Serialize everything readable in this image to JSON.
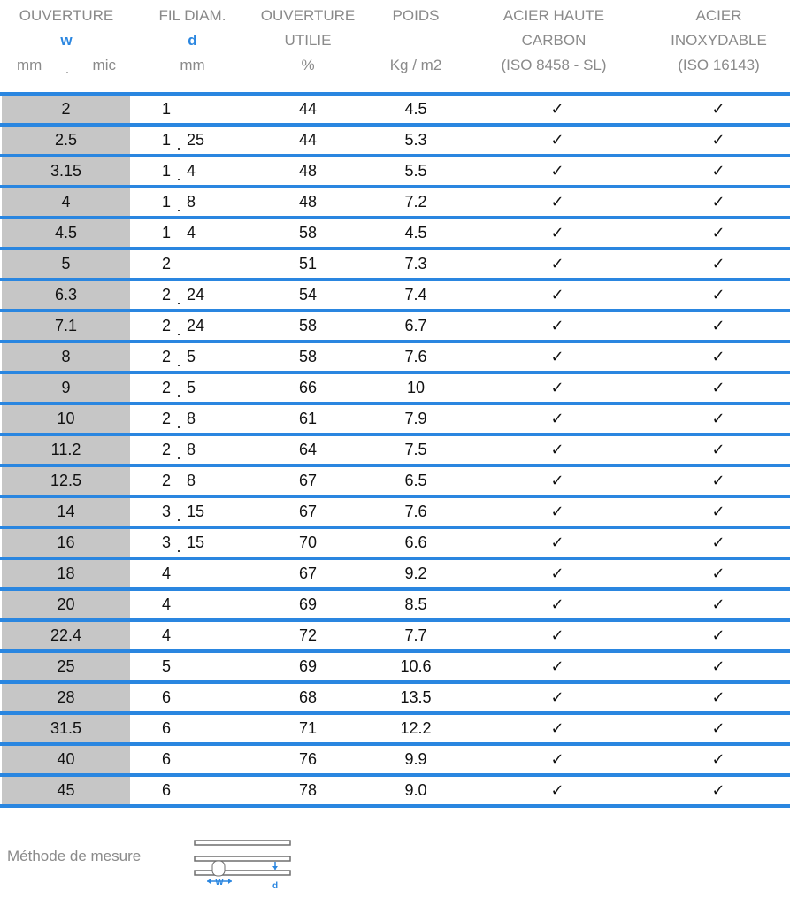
{
  "header": {
    "col_w": {
      "line1": "OUVERTURE",
      "symbol": "w",
      "unit_left": "mm",
      "unit_sep": ".",
      "unit_right": "mic"
    },
    "col_d": {
      "line1": "FIL DIAM.",
      "symbol": "d",
      "unit": "mm"
    },
    "col_o": {
      "line1": "OUVERTURE",
      "line2": "UTILIE",
      "unit": "%"
    },
    "col_p": {
      "line1": "POIDS",
      "unit": "Kg / m2"
    },
    "col_a": {
      "line1": "ACIER HAUTE",
      "line2": "CARBON",
      "line3": "(ISO 8458 - SL)"
    },
    "col_i": {
      "line1": "ACIER",
      "line2": "INOXYDABLE",
      "line3": "(ISO 16143)"
    }
  },
  "colors": {
    "accent": "#2a86e0",
    "first_col_bg": "#c6c6c6",
    "header_text": "#8a8a8a"
  },
  "rows": [
    {
      "w": "2",
      "d_int": "1",
      "d_sep": "",
      "d_dec": "",
      "open": "44",
      "weight": "4.5",
      "carbon": "✓",
      "inox": "✓"
    },
    {
      "w": "2.5",
      "d_int": "1",
      "d_sep": ".",
      "d_dec": "25",
      "open": "44",
      "weight": "5.3",
      "carbon": "✓",
      "inox": "✓"
    },
    {
      "w": "3.15",
      "d_int": "1",
      "d_sep": ".",
      "d_dec": "4",
      "open": "48",
      "weight": "5.5",
      "carbon": "✓",
      "inox": "✓"
    },
    {
      "w": "4",
      "d_int": "1",
      "d_sep": ".",
      "d_dec": "8",
      "open": "48",
      "weight": "7.2",
      "carbon": "✓",
      "inox": "✓"
    },
    {
      "w": "4.5",
      "d_int": "1",
      "d_sep": "",
      "d_dec": "4",
      "open": "58",
      "weight": "4.5",
      "carbon": "✓",
      "inox": "✓"
    },
    {
      "w": "5",
      "d_int": "2",
      "d_sep": "",
      "d_dec": "",
      "open": "51",
      "weight": "7.3",
      "carbon": "✓",
      "inox": "✓"
    },
    {
      "w": "6.3",
      "d_int": "2",
      "d_sep": ".",
      "d_dec": "24",
      "open": "54",
      "weight": "7.4",
      "carbon": "✓",
      "inox": "✓"
    },
    {
      "w": "7.1",
      "d_int": "2",
      "d_sep": ".",
      "d_dec": "24",
      "open": "58",
      "weight": "6.7",
      "carbon": "✓",
      "inox": "✓"
    },
    {
      "w": "8",
      "d_int": "2",
      "d_sep": ".",
      "d_dec": "5",
      "open": "58",
      "weight": "7.6",
      "carbon": "✓",
      "inox": "✓"
    },
    {
      "w": "9",
      "d_int": "2",
      "d_sep": ".",
      "d_dec": "5",
      "open": "66",
      "weight": "10",
      "carbon": "✓",
      "inox": "✓"
    },
    {
      "w": "10",
      "d_int": "2",
      "d_sep": ".",
      "d_dec": "8",
      "open": "61",
      "weight": "7.9",
      "carbon": "✓",
      "inox": "✓"
    },
    {
      "w": "11.2",
      "d_int": "2",
      "d_sep": ".",
      "d_dec": "8",
      "open": "64",
      "weight": "7.5",
      "carbon": "✓",
      "inox": "✓"
    },
    {
      "w": "12.5",
      "d_int": "2",
      "d_sep": "",
      "d_dec": "8",
      "open": "67",
      "weight": "6.5",
      "carbon": "✓",
      "inox": "✓"
    },
    {
      "w": "14",
      "d_int": "3",
      "d_sep": ".",
      "d_dec": "15",
      "open": "67",
      "weight": "7.6",
      "carbon": "✓",
      "inox": "✓"
    },
    {
      "w": "16",
      "d_int": "3",
      "d_sep": ".",
      "d_dec": "15",
      "open": "70",
      "weight": "6.6",
      "carbon": "✓",
      "inox": "✓"
    },
    {
      "w": "18",
      "d_int": "4",
      "d_sep": "",
      "d_dec": "",
      "open": "67",
      "weight": "9.2",
      "carbon": "✓",
      "inox": "✓"
    },
    {
      "w": "20",
      "d_int": "4",
      "d_sep": "",
      "d_dec": "",
      "open": "69",
      "weight": "8.5",
      "carbon": "✓",
      "inox": "✓"
    },
    {
      "w": "22.4",
      "d_int": "4",
      "d_sep": "",
      "d_dec": "",
      "open": "72",
      "weight": "7.7",
      "carbon": "✓",
      "inox": "✓"
    },
    {
      "w": "25",
      "d_int": "5",
      "d_sep": "",
      "d_dec": "",
      "open": "69",
      "weight": "10.6",
      "carbon": "✓",
      "inox": "✓"
    },
    {
      "w": "28",
      "d_int": "6",
      "d_sep": "",
      "d_dec": "",
      "open": "68",
      "weight": "13.5",
      "carbon": "✓",
      "inox": "✓"
    },
    {
      "w": "31.5",
      "d_int": "6",
      "d_sep": "",
      "d_dec": "",
      "open": "71",
      "weight": "12.2",
      "carbon": "✓",
      "inox": "✓"
    },
    {
      "w": "40",
      "d_int": "6",
      "d_sep": "",
      "d_dec": "",
      "open": "76",
      "weight": "9.9",
      "carbon": "✓",
      "inox": "✓"
    },
    {
      "w": "45",
      "d_int": "6",
      "d_sep": "",
      "d_dec": "",
      "open": "78",
      "weight": "9.0",
      "carbon": "✓",
      "inox": "✓"
    }
  ],
  "footer": {
    "label": "Méthode de mesure",
    "diagram_w": "W",
    "diagram_d": "d"
  }
}
